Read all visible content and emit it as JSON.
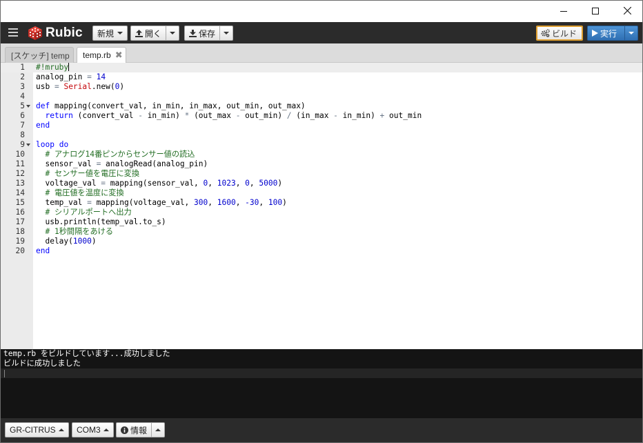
{
  "window": {
    "controls": [
      "minimize-icon",
      "maximize-icon",
      "close-icon"
    ]
  },
  "toolbar": {
    "menu_icon": "hamburger-icon",
    "app_name": "Rubic",
    "new_label": "新規",
    "open_label": "開く",
    "save_label": "保存",
    "build_label": "ビルド",
    "run_label": "実行",
    "build_border_color": "#e0a030",
    "run_color": "#2f6fb3"
  },
  "tabs": [
    {
      "label": "[スケッチ] temp",
      "active": false
    },
    {
      "label": "temp.rb",
      "active": true,
      "close": "✖"
    }
  ],
  "editor": {
    "lines": [
      {
        "n": "1",
        "fold": false,
        "tokens": [
          [
            "c-comment",
            "#!mruby"
          ]
        ],
        "cursor": true
      },
      {
        "n": "2",
        "fold": false,
        "tokens": [
          [
            "",
            "analog_pin "
          ],
          [
            "c-op",
            "="
          ],
          [
            "",
            " "
          ],
          [
            "c-num",
            "14"
          ]
        ]
      },
      {
        "n": "3",
        "fold": false,
        "tokens": [
          [
            "",
            "usb "
          ],
          [
            "c-op",
            "="
          ],
          [
            "",
            " "
          ],
          [
            "c-const",
            "Serial"
          ],
          [
            "",
            ".new("
          ],
          [
            "c-num",
            "0"
          ],
          [
            "",
            ")"
          ]
        ]
      },
      {
        "n": "4",
        "fold": false,
        "tokens": []
      },
      {
        "n": "5",
        "fold": true,
        "tokens": [
          [
            "c-kw",
            "def"
          ],
          [
            "",
            " mapping(convert_val, in_min, in_max, out_min, out_max)"
          ]
        ]
      },
      {
        "n": "6",
        "fold": false,
        "tokens": [
          [
            "",
            "  "
          ],
          [
            "c-kw",
            "return"
          ],
          [
            "",
            " (convert_val "
          ],
          [
            "c-op",
            "-"
          ],
          [
            "",
            " in_min) "
          ],
          [
            "c-op",
            "*"
          ],
          [
            "",
            " (out_max "
          ],
          [
            "c-op",
            "-"
          ],
          [
            "",
            " out_min) "
          ],
          [
            "c-op",
            "/"
          ],
          [
            "",
            " (in_max "
          ],
          [
            "c-op",
            "-"
          ],
          [
            "",
            " in_min) "
          ],
          [
            "c-op",
            "+"
          ],
          [
            "",
            " out_min"
          ]
        ]
      },
      {
        "n": "7",
        "fold": false,
        "tokens": [
          [
            "c-kw",
            "end"
          ]
        ]
      },
      {
        "n": "8",
        "fold": false,
        "tokens": []
      },
      {
        "n": "9",
        "fold": true,
        "tokens": [
          [
            "c-kw",
            "loop"
          ],
          [
            "",
            " "
          ],
          [
            "c-kw",
            "do"
          ]
        ]
      },
      {
        "n": "10",
        "fold": false,
        "tokens": [
          [
            "",
            "  "
          ],
          [
            "c-comment",
            "# アナログ14番ピンからセンサー値の読込"
          ]
        ]
      },
      {
        "n": "11",
        "fold": false,
        "tokens": [
          [
            "",
            "  sensor_val "
          ],
          [
            "c-op",
            "="
          ],
          [
            "",
            " analogRead(analog_pin)"
          ]
        ]
      },
      {
        "n": "12",
        "fold": false,
        "tokens": [
          [
            "",
            "  "
          ],
          [
            "c-comment",
            "# センサー値を電圧に変換"
          ]
        ]
      },
      {
        "n": "13",
        "fold": false,
        "tokens": [
          [
            "",
            "  voltage_val "
          ],
          [
            "c-op",
            "="
          ],
          [
            "",
            " mapping(sensor_val, "
          ],
          [
            "c-num",
            "0"
          ],
          [
            "",
            ", "
          ],
          [
            "c-num",
            "1023"
          ],
          [
            "",
            ", "
          ],
          [
            "c-num",
            "0"
          ],
          [
            "",
            ", "
          ],
          [
            "c-num",
            "5000"
          ],
          [
            "",
            ")"
          ]
        ]
      },
      {
        "n": "14",
        "fold": false,
        "tokens": [
          [
            "",
            "  "
          ],
          [
            "c-comment",
            "# 電圧値を温度に変換"
          ]
        ]
      },
      {
        "n": "15",
        "fold": false,
        "tokens": [
          [
            "",
            "  temp_val "
          ],
          [
            "c-op",
            "="
          ],
          [
            "",
            " mapping(voltage_val, "
          ],
          [
            "c-num",
            "300"
          ],
          [
            "",
            ", "
          ],
          [
            "c-num",
            "1600"
          ],
          [
            "",
            ", "
          ],
          [
            "c-num",
            "-30"
          ],
          [
            "",
            ", "
          ],
          [
            "c-num",
            "100"
          ],
          [
            "",
            ")"
          ]
        ]
      },
      {
        "n": "16",
        "fold": false,
        "tokens": [
          [
            "",
            "  "
          ],
          [
            "c-comment",
            "# シリアルポートへ出力"
          ]
        ]
      },
      {
        "n": "17",
        "fold": false,
        "tokens": [
          [
            "",
            "  usb.println(temp_val.to_s)"
          ]
        ]
      },
      {
        "n": "18",
        "fold": false,
        "tokens": [
          [
            "",
            "  "
          ],
          [
            "c-comment",
            "# 1秒間隔をあける"
          ]
        ]
      },
      {
        "n": "19",
        "fold": false,
        "tokens": [
          [
            "",
            "  delay("
          ],
          [
            "c-num",
            "1000"
          ],
          [
            "",
            ")"
          ]
        ]
      },
      {
        "n": "20",
        "fold": false,
        "tokens": [
          [
            "c-kw",
            "end"
          ]
        ]
      }
    ]
  },
  "console": {
    "lines": [
      "temp.rb をビルドしています...成功しました",
      "ビルドに成功しました"
    ]
  },
  "statusbar": {
    "board_label": "GR-CITRUS",
    "port_label": "COM3",
    "info_label": "情報"
  }
}
